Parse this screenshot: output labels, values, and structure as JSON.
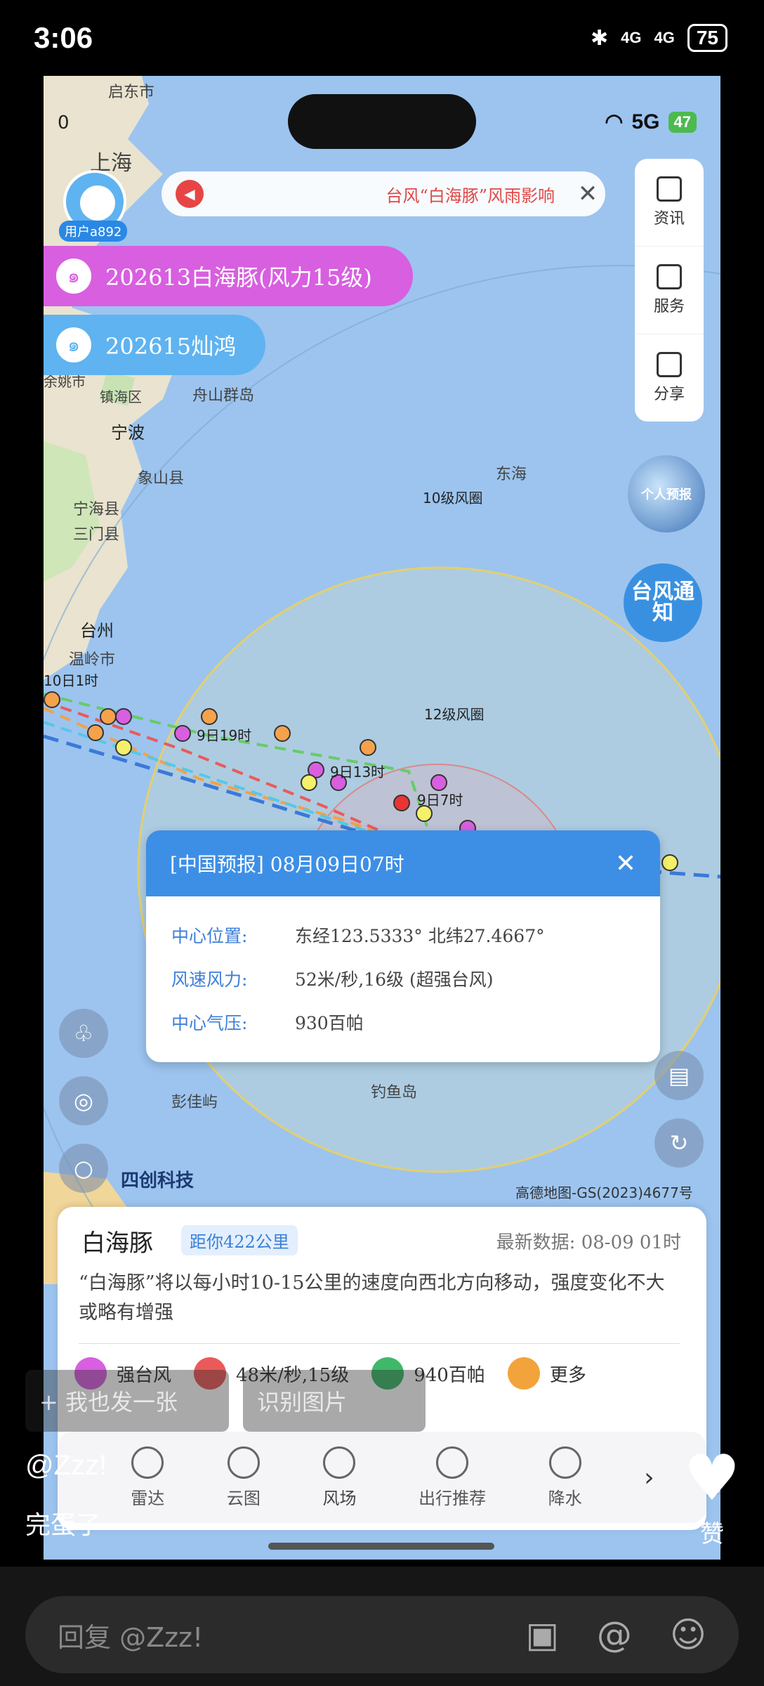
{
  "status_bar": {
    "time": "3:06",
    "network1": "4G",
    "network2": "4G",
    "battery": "75"
  },
  "inner_status": {
    "time": "0",
    "net": "5G",
    "battery": "47"
  },
  "user": {
    "tag": "用户a892"
  },
  "notice": {
    "text": "台风“白海豚”风雨影响"
  },
  "side_menu": {
    "items": [
      {
        "label": "资讯"
      },
      {
        "label": "服务"
      },
      {
        "label": "分享"
      }
    ]
  },
  "typhoons": [
    {
      "label": "202613白海豚(风力15级)",
      "color": "#d85fe0"
    },
    {
      "label": "202615灿鸿",
      "color": "#5fb3f0"
    }
  ],
  "badges": {
    "personal": "个人预报",
    "notice": "台风通知"
  },
  "map_labels": {
    "qidong": "启东市",
    "shanghai": "上海",
    "ningbo": "宁波",
    "xiangshan": "象山县",
    "ninghai": "宁海县",
    "sanmen": "三门县",
    "taizhou": "台州",
    "wenling": "温岭市",
    "zhoushan": "舟山群岛",
    "donghai": "东海",
    "ring10": "10级风圈",
    "ring12": "12级风圈",
    "t1": "10日1时",
    "t2": "9日19时",
    "t3": "9日13时",
    "t4": "9日7时",
    "pengjia": "彭佳屿",
    "diaoyu": "钓鱼岛",
    "zhenhai": "镇海区",
    "yuyao": "余姚市"
  },
  "info_card": {
    "title": "[中国预报] 08月09日07时",
    "rows": [
      {
        "key": "中心位置:",
        "value": "东经123.5333°   北纬27.4667°"
      },
      {
        "key": "风速风力:",
        "value": "52米/秒,16级 (超强台风)"
      },
      {
        "key": "中心气压:",
        "value": "930百帕"
      }
    ]
  },
  "watermarks": {
    "logo": "四创科技",
    "amap": "高德地图-GS(2023)4677号"
  },
  "panel": {
    "name": "白海豚",
    "distance": "距你422公里",
    "latest": "最新数据: 08-09 01时",
    "description": "“白海豚”将以每小时10-15公里的速度向西北方向移动，强度变化不大或略有增强",
    "stats": [
      {
        "label": "强台风",
        "color": "#d85fe0"
      },
      {
        "label": "48米/秒,15级",
        "color": "#ea5a5a"
      },
      {
        "label": "940百帕",
        "color": "#3fb86a"
      },
      {
        "label": "更多",
        "color": "#f3a33c"
      }
    ]
  },
  "toolbar": {
    "items": [
      {
        "label": "雷达"
      },
      {
        "label": "云图"
      },
      {
        "label": "风场"
      },
      {
        "label": "出行推荐"
      },
      {
        "label": "降水"
      }
    ]
  },
  "overlay": {
    "post_button": "+ 我也发一张",
    "identify_button": "识别图片",
    "username": "@Zzz!",
    "caption": "完蛋了",
    "like_label": "赞"
  },
  "reply": {
    "placeholder": "回复 @Zzz!"
  }
}
